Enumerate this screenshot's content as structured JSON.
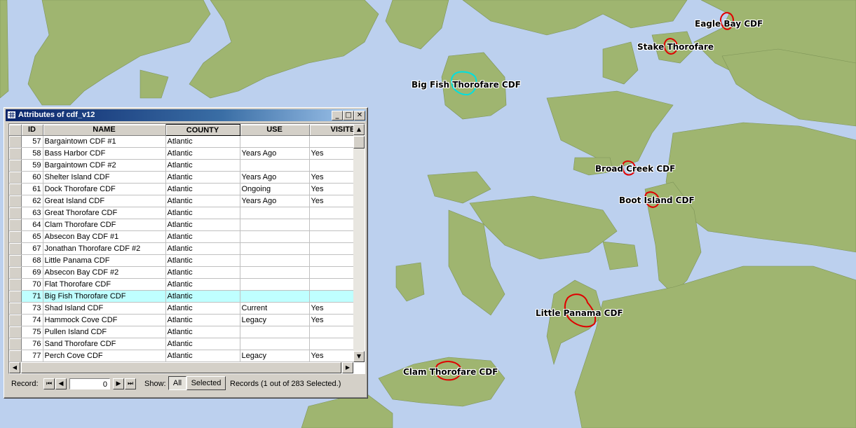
{
  "map": {
    "labels": {
      "eagle_bay": "Eagle Bay CDF",
      "stake_thorofare": "Stake Thorofare",
      "big_fish_thorofare": "Big Fish Thorofare CDF",
      "broad_creek": "Broad Creek CDF",
      "boot_island": "Boot Island CDF",
      "little_panama": "Little Panama CDF",
      "clam_thorofare": "Clam Thorofare CDF"
    },
    "colors": {
      "water": "#bcd0ee",
      "land": "#9fb570",
      "site_outline": "#e00000",
      "selected_outline": "#00e0e0"
    }
  },
  "window": {
    "title": "Attributes of cdf_v12",
    "minimize_label": "_",
    "maximize_label": "□",
    "close_label": "✕"
  },
  "table": {
    "columns": [
      "ID",
      "NAME",
      "COUNTY",
      "USE",
      "VISITE"
    ],
    "rows": [
      {
        "id": "57",
        "name": "Bargaintown CDF #1",
        "county": "Atlantic",
        "use": "",
        "visited": ""
      },
      {
        "id": "58",
        "name": "Bass Harbor CDF",
        "county": "Atlantic",
        "use": "Years Ago",
        "visited": "Yes"
      },
      {
        "id": "59",
        "name": "Bargaintown CDF #2",
        "county": "Atlantic",
        "use": "",
        "visited": ""
      },
      {
        "id": "60",
        "name": "Shelter Island CDF",
        "county": "Atlantic",
        "use": "Years Ago",
        "visited": "Yes"
      },
      {
        "id": "61",
        "name": "Dock Thorofare CDF",
        "county": "Atlantic",
        "use": "Ongoing",
        "visited": "Yes"
      },
      {
        "id": "62",
        "name": "Great Island CDF",
        "county": "Atlantic",
        "use": "Years Ago",
        "visited": "Yes"
      },
      {
        "id": "63",
        "name": "Great Thorofare CDF",
        "county": "Atlantic",
        "use": "",
        "visited": ""
      },
      {
        "id": "64",
        "name": "Clam Thorofare CDF",
        "county": "Atlantic",
        "use": "",
        "visited": ""
      },
      {
        "id": "65",
        "name": "Absecon Bay CDF #1",
        "county": "Atlantic",
        "use": "",
        "visited": ""
      },
      {
        "id": "67",
        "name": "Jonathan Thorofare CDF #2",
        "county": "Atlantic",
        "use": "",
        "visited": ""
      },
      {
        "id": "68",
        "name": "Little Panama CDF",
        "county": "Atlantic",
        "use": "",
        "visited": ""
      },
      {
        "id": "69",
        "name": "Absecon Bay CDF #2",
        "county": "Atlantic",
        "use": "",
        "visited": ""
      },
      {
        "id": "70",
        "name": "Flat Thorofare CDF",
        "county": "Atlantic",
        "use": "",
        "visited": ""
      },
      {
        "id": "71",
        "name": "Big Fish Thorofare CDF",
        "county": "Atlantic",
        "use": "",
        "visited": "",
        "selected": true
      },
      {
        "id": "73",
        "name": "Shad Island CDF",
        "county": "Atlantic",
        "use": "Current",
        "visited": "Yes"
      },
      {
        "id": "74",
        "name": "Hammock Cove CDF",
        "county": "Atlantic",
        "use": "Legacy",
        "visited": "Yes"
      },
      {
        "id": "75",
        "name": "Pullen Island CDF",
        "county": "Atlantic",
        "use": "",
        "visited": ""
      },
      {
        "id": "76",
        "name": "Sand Thorofare CDF",
        "county": "Atlantic",
        "use": "",
        "visited": ""
      },
      {
        "id": "77",
        "name": "Perch Cove CDF",
        "county": "Atlantic",
        "use": "Legacy",
        "visited": "Yes"
      }
    ],
    "highlight_color": "#bfffff"
  },
  "footer": {
    "record_label": "Record:",
    "record_value": "0",
    "show_label": "Show:",
    "all_label": "All",
    "selected_label": "Selected",
    "records_status": "Records  (1 out of 283 Selected.)"
  }
}
